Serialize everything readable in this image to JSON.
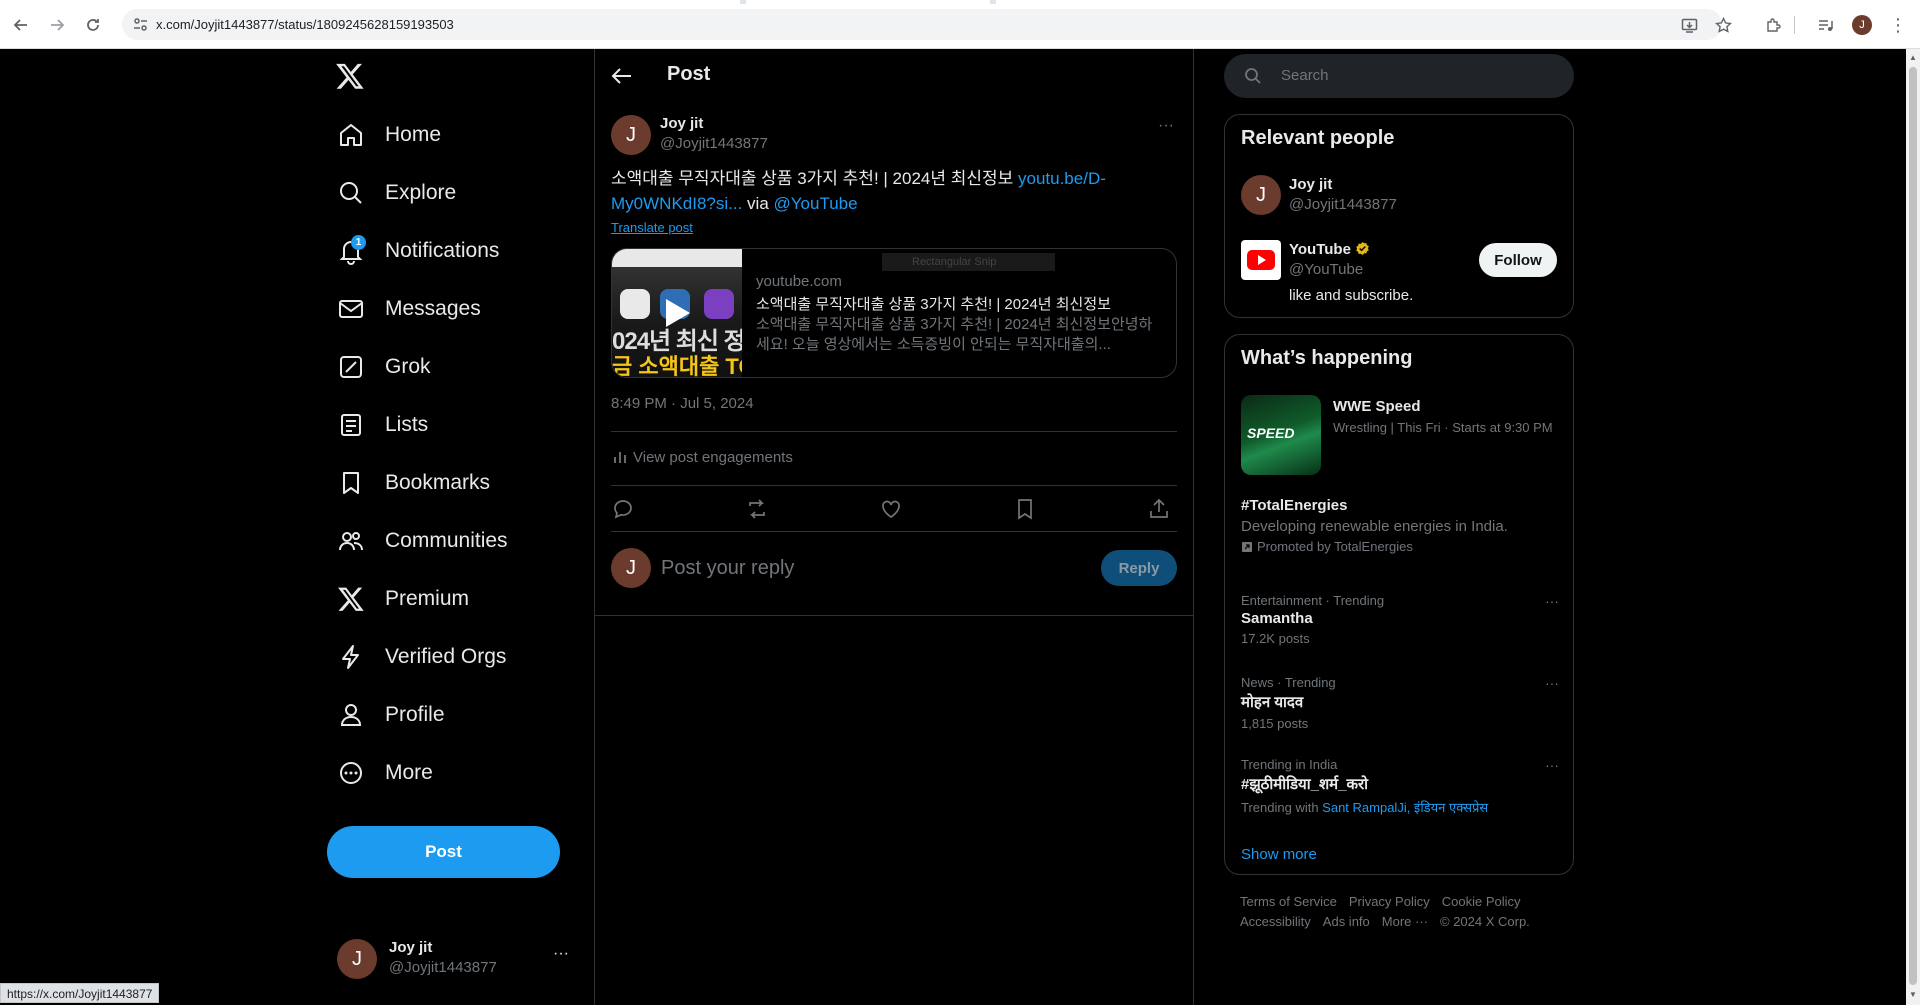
{
  "browser": {
    "url": "x.com/Joyjit1443877/status/1809245628159193503",
    "status_url": "https://x.com/Joyjit1443877",
    "profile_initial": "J"
  },
  "nav": {
    "items": [
      {
        "label": "Home",
        "icon": "home-icon"
      },
      {
        "label": "Explore",
        "icon": "search-icon"
      },
      {
        "label": "Notifications",
        "icon": "bell-icon",
        "badge": "1"
      },
      {
        "label": "Messages",
        "icon": "envelope-icon"
      },
      {
        "label": "Grok",
        "icon": "grok-icon"
      },
      {
        "label": "Lists",
        "icon": "list-icon"
      },
      {
        "label": "Bookmarks",
        "icon": "bookmark-icon"
      },
      {
        "label": "Communities",
        "icon": "people-icon"
      },
      {
        "label": "Premium",
        "icon": "x-logo-icon"
      },
      {
        "label": "Verified Orgs",
        "icon": "lightning-icon"
      },
      {
        "label": "Profile",
        "icon": "person-icon"
      },
      {
        "label": "More",
        "icon": "more-circle-icon"
      }
    ],
    "post_label": "Post",
    "account": {
      "initial": "J",
      "name": "Joy jit",
      "handle": "@Joyjit1443877",
      "more": "···"
    }
  },
  "main": {
    "header_title": "Post",
    "tweet": {
      "initial": "J",
      "name": "Joy jit",
      "handle": "@Joyjit1443877",
      "more": "···",
      "text": "소액대출 무직자대출 상품 3가지 추천! | 2024년 최신정보 ",
      "link1": "youtu.be/D-My0WNKdI8?si...",
      "via": " via ",
      "link2": "@YouTube",
      "translate": "Translate post",
      "card": {
        "domain": "youtube.com",
        "title": "소액대출 무직자대출 상품 3가지 추천! | 2024년 최신정보",
        "desc": "소액대출 무직자대출 상품 3가지 추천! | 2024년 최신정보안녕하세요! 오늘 영상에서는 소득증빙이 안되는 무직자대출의...",
        "thumb_line1": "024년 최신 정",
        "thumb_line2": "금 소액대출 TO",
        "ghost": "Rectangular Snip"
      },
      "timestamp": "8:49 PM · Jul 5, 2024",
      "engagements": "View post engagements"
    },
    "reply": {
      "initial": "J",
      "placeholder": "Post your reply",
      "button": "Reply"
    }
  },
  "right": {
    "search_placeholder": "Search",
    "relevant": {
      "title": "Relevant people",
      "people": [
        {
          "initial": "J",
          "name": "Joy jit",
          "handle": "@Joyjit1443877"
        },
        {
          "name": "YouTube",
          "handle": "@YouTube",
          "bio": "like and subscribe.",
          "follow": "Follow"
        }
      ]
    },
    "happening": {
      "title": "What’s happening",
      "wwe": {
        "title": "WWE Speed",
        "meta": "Wrestling | This Fri · Starts at 9:30 PM",
        "img_text": "SPEED"
      },
      "promo": {
        "title": "#TotalEnergies",
        "desc": "Developing renewable energies in India.",
        "promoted": "Promoted by TotalEnergies"
      },
      "trends": [
        {
          "meta": "Entertainment · Trending",
          "title": "Samantha",
          "count": "17.2K posts"
        },
        {
          "meta": "News · Trending",
          "title": "मोहन यादव",
          "count": "1,815 posts"
        },
        {
          "meta": "Trending in India",
          "title": "#झूठीमीडिया_शर्म_करो",
          "with_label": "Trending with ",
          "with_links": "Sant RampalJi, इंडियन एक्सप्रेस"
        }
      ],
      "show_more": "Show more"
    },
    "footer": {
      "links": [
        "Terms of Service",
        "Privacy Policy",
        "Cookie Policy",
        "Accessibility",
        "Ads info",
        "More ···"
      ],
      "copyright": "© 2024 X Corp."
    }
  }
}
